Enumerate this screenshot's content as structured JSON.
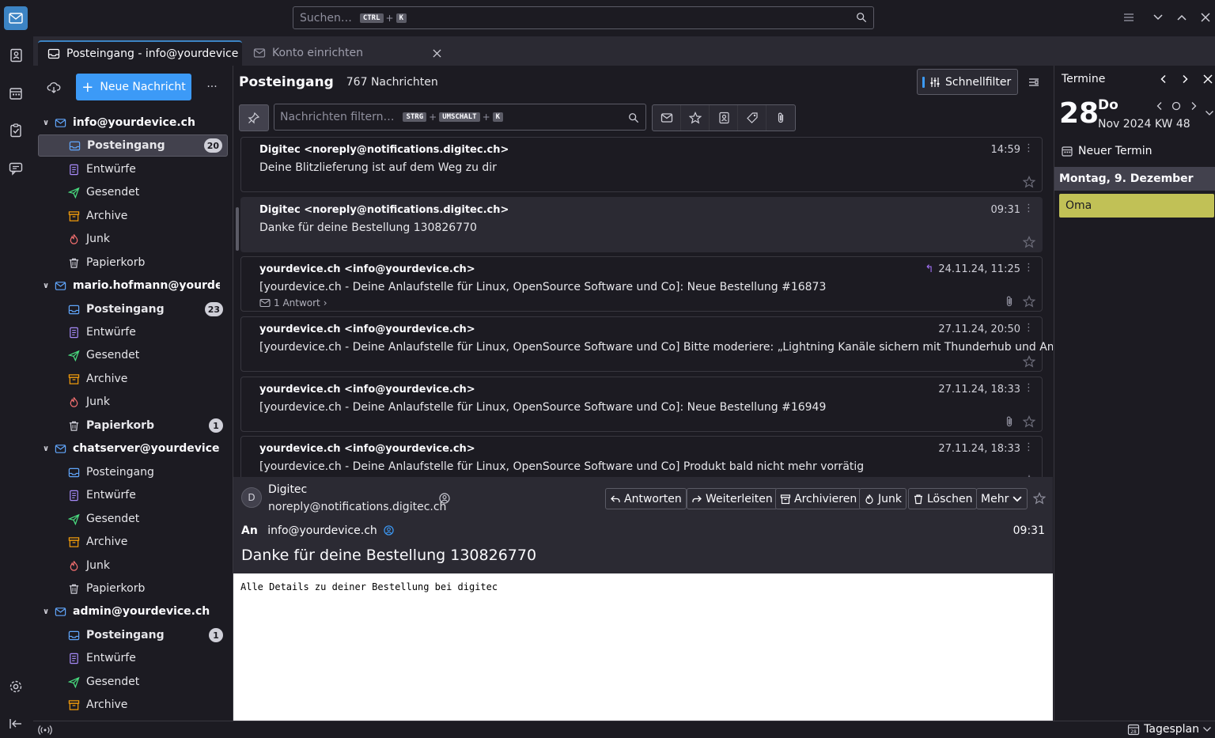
{
  "search": {
    "placeholder": "Suchen…",
    "key1": "CTRL",
    "key2": "K"
  },
  "tabs": [
    {
      "label": "Posteingang - info@yourdevice.ch"
    },
    {
      "label": "Konto einrichten"
    }
  ],
  "folderpane": {
    "new_message": "Neue Nachricht",
    "accounts": [
      {
        "name": "info@yourdevice.ch",
        "folders": [
          {
            "name": "Posteingang",
            "badge": "20"
          },
          {
            "name": "Entwürfe"
          },
          {
            "name": "Gesendet"
          },
          {
            "name": "Archive"
          },
          {
            "name": "Junk"
          },
          {
            "name": "Papierkorb"
          }
        ]
      },
      {
        "name": "mario.hofmann@yourde...",
        "folders": [
          {
            "name": "Posteingang",
            "badge": "23"
          },
          {
            "name": "Entwürfe"
          },
          {
            "name": "Gesendet"
          },
          {
            "name": "Archive"
          },
          {
            "name": "Junk"
          },
          {
            "name": "Papierkorb",
            "badge": "1"
          }
        ]
      },
      {
        "name": "chatserver@yourdevice....",
        "folders": [
          {
            "name": "Posteingang"
          },
          {
            "name": "Entwürfe"
          },
          {
            "name": "Gesendet"
          },
          {
            "name": "Archive"
          },
          {
            "name": "Junk"
          },
          {
            "name": "Papierkorb"
          }
        ]
      },
      {
        "name": "admin@yourdevice.ch",
        "folders": [
          {
            "name": "Posteingang",
            "badge": "1"
          },
          {
            "name": "Entwürfe"
          },
          {
            "name": "Gesendet"
          },
          {
            "name": "Archive"
          }
        ]
      }
    ]
  },
  "threadpane": {
    "title": "Posteingang",
    "count": "767 Nachrichten",
    "quickfilter": "Schnellfilter",
    "filter_placeholder": "Nachrichten filtern…",
    "filter_key1": "STRG",
    "filter_key2": "UMSCHALT",
    "filter_key3": "K",
    "messages": [
      {
        "sender": "Digitec <noreply@notifications.digitec.ch>",
        "subject": "Deine Blitzlieferung ist auf dem Weg zu dir",
        "date": "14:59"
      },
      {
        "sender": "Digitec <noreply@notifications.digitec.ch>",
        "subject": "Danke für deine Bestellung 130826770",
        "date": "09:31"
      },
      {
        "sender": "yourdevice.ch <info@yourdevice.ch>",
        "subject": "[yourdevice.ch - Deine Anlaufstelle für Linux, OpenSource Software und Co]: Neue Bestellung #16873",
        "date": "24.11.24, 11:25",
        "replies": "1 Antwort"
      },
      {
        "sender": "yourdevice.ch <info@yourdevice.ch>",
        "subject": "[yourdevice.ch - Deine Anlaufstelle für Linux, OpenSource Software und Co] Bitte moderiere: „Lightning Kanäle sichern mit Thunderhub und Amboss“",
        "date": "27.11.24, 20:50"
      },
      {
        "sender": "yourdevice.ch <info@yourdevice.ch>",
        "subject": "[yourdevice.ch - Deine Anlaufstelle für Linux, OpenSource Software und Co]: Neue Bestellung #16949",
        "date": "27.11.24, 18:33"
      },
      {
        "sender": "yourdevice.ch <info@yourdevice.ch>",
        "subject": "[yourdevice.ch - Deine Anlaufstelle für Linux, OpenSource Software und Co] Produkt bald nicht mehr vorrätig",
        "date": "27.11.24, 18:33"
      }
    ]
  },
  "message": {
    "avatar_letter": "D",
    "from_name": "Digitec",
    "from_addr": "noreply@notifications.digitec.ch",
    "buttons": {
      "reply": "Antworten",
      "forward": "Weiterleiten",
      "archive": "Archivieren",
      "junk": "Junk",
      "delete": "Löschen",
      "more": "Mehr"
    },
    "to_label": "An",
    "to_addr": "info@yourdevice.ch",
    "time": "09:31",
    "subject": "Danke für deine Bestellung 130826770",
    "body": "Alle Details zu deiner Bestellung bei digitec"
  },
  "todaypane": {
    "title": "Termine",
    "day_number": "28",
    "day_name": "Do",
    "month_week": "Nov 2024  KW 48",
    "new_event": "Neuer Termin",
    "day_header": "Montag, 9. Dezember",
    "event": "Oma"
  },
  "statusbar": {
    "tagesplan": "Tagesplan"
  },
  "colors": {
    "accent": "#3c9af7",
    "event": "#c1c156",
    "reply_arrow": "#a371f7"
  }
}
